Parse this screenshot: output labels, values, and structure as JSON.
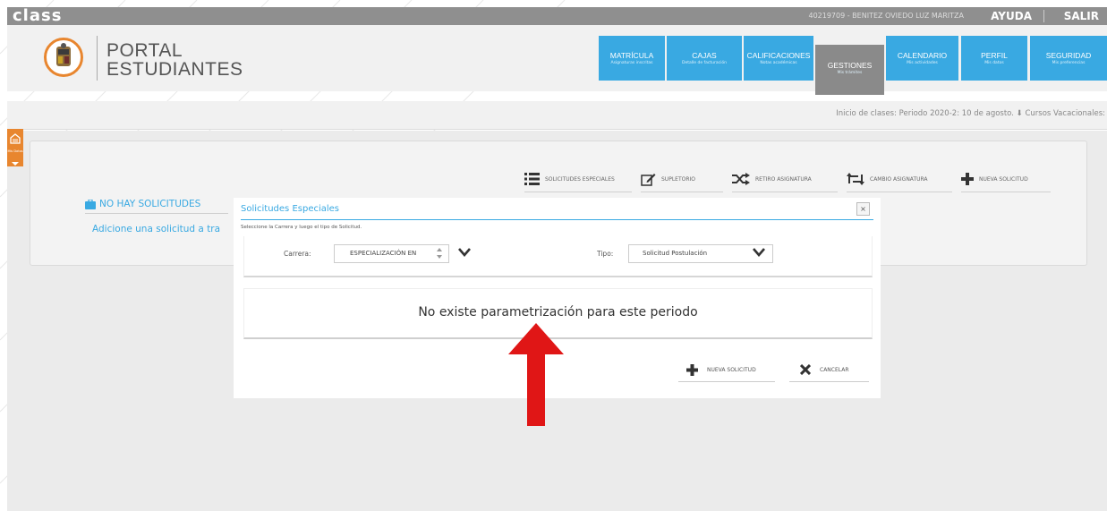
{
  "topbar": {
    "logo": "class",
    "user": "40219709 - BENITEZ OVIEDO LUZ MARITZA",
    "help": "AYUDA",
    "logout": "SALIR"
  },
  "header": {
    "portal_line1": "PORTAL",
    "portal_line2": "ESTUDIANTES",
    "nav": [
      {
        "title": "MATRÍCULA",
        "sub": "Asignaturas inscritas"
      },
      {
        "title": "CAJAS",
        "sub": "Detalle de facturación"
      },
      {
        "title": "CALIFICACIONES",
        "sub": "Notas académicas"
      },
      {
        "title": "GESTIONES",
        "sub": "Mis trámites"
      },
      {
        "title": "CALENDARIO",
        "sub": "Mis actividades"
      },
      {
        "title": "PERFIL",
        "sub": "Mis datos"
      },
      {
        "title": "SEGURIDAD",
        "sub": "Mis preferencias"
      }
    ]
  },
  "info_bar": {
    "text": "Inicio de clases:  Periodo 2020-2: 10 de agosto.  ⬇  Cursos Vacacionales:"
  },
  "side_tab": {
    "label": "Mis Datos"
  },
  "actions": {
    "special": "SOLICITUDES ESPECIALES",
    "supletorio": "SUPLETORIO",
    "retiro": "RETIRO ASIGNATURA",
    "cambio": "CAMBIO ASIGNATURA",
    "nueva": "NUEVA SOLICITUD"
  },
  "content": {
    "no_requests": "NO HAY SOLICITUDES",
    "add_hint": "Adicione una solicitud a tra"
  },
  "modal": {
    "title": "Solicitudes Especiales",
    "close": "×",
    "instruction": "Seleccione la Carrera y luego el tipo de Solicitud.",
    "carrera_label": "Carrera:",
    "carrera_value": "ESPECIALIZACIÓN EN",
    "tipo_label": "Tipo:",
    "tipo_value": "Solicitud Postulación",
    "message": "No existe parametrización para este periodo",
    "new_button": "NUEVA SOLICITUD",
    "cancel_button": "CANCELAR"
  },
  "colors": {
    "accent": "#39a9e2",
    "active_nav": "#8a8a8a",
    "brand_orange": "#e8862f",
    "arrow": "#e01616"
  }
}
